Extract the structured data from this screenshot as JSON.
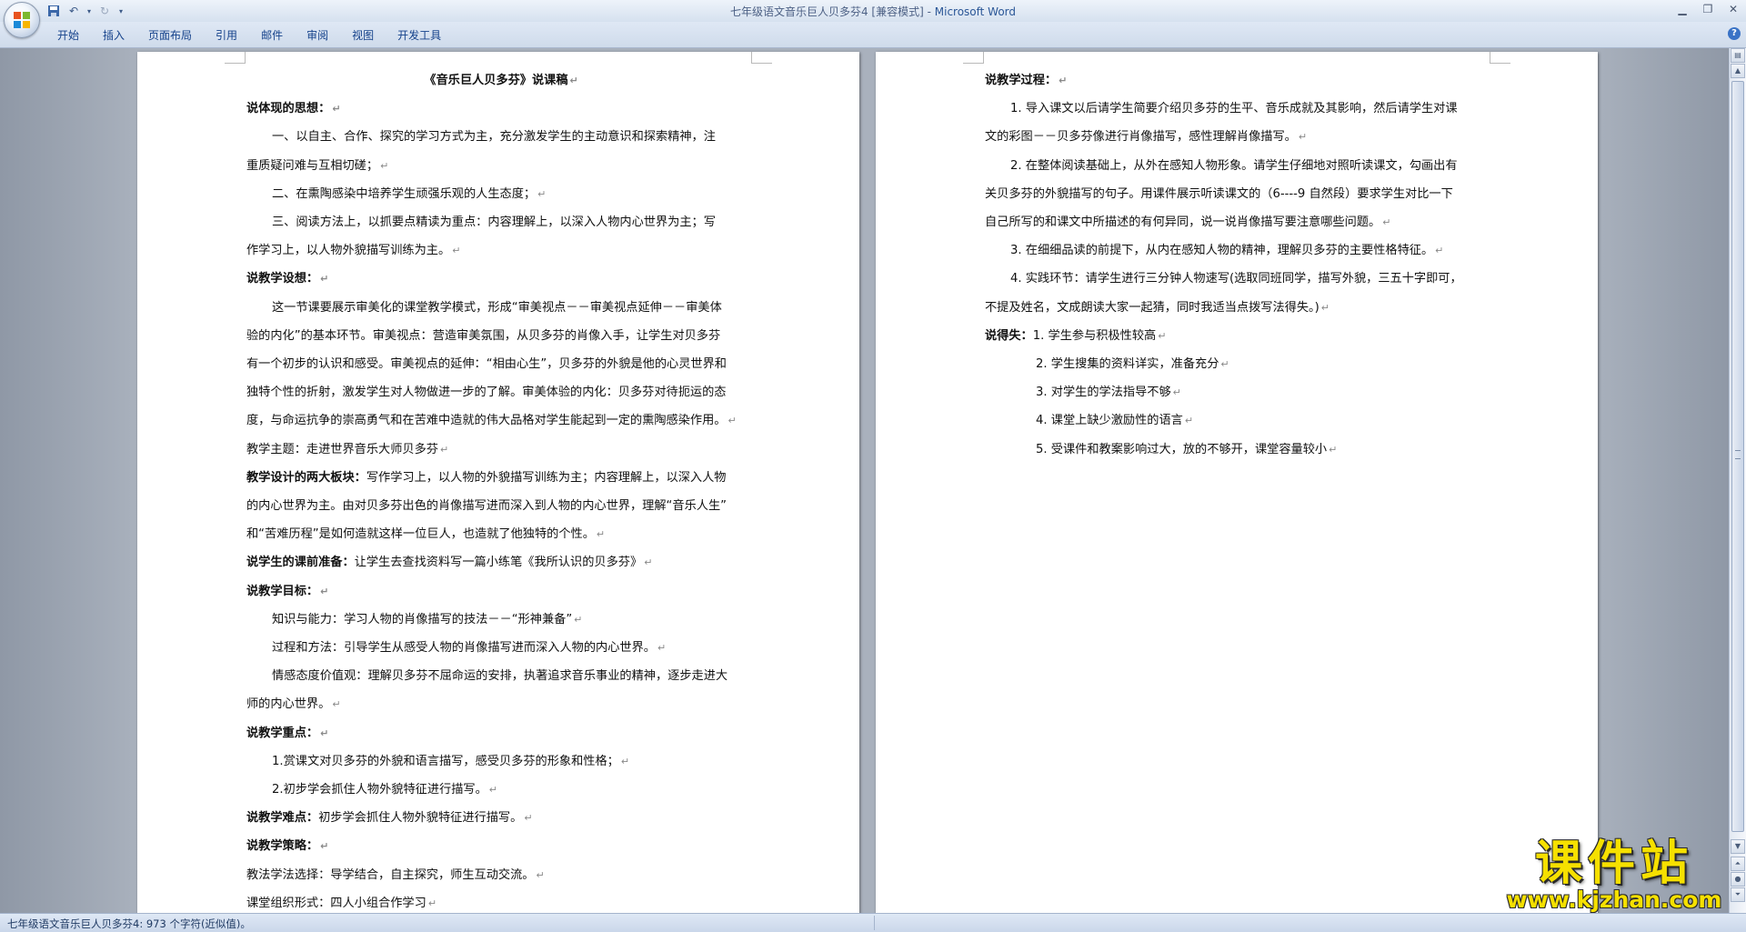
{
  "window": {
    "title": "七年级语文音乐巨人贝多芬4 [兼容模式] - ",
    "app_name": "Microsoft Word"
  },
  "ribbon": {
    "tabs": [
      "开始",
      "插入",
      "页面布局",
      "引用",
      "邮件",
      "审阅",
      "视图",
      "开发工具"
    ]
  },
  "page_left": {
    "title": "《音乐巨人贝多芬》说课稿",
    "s1_head": "说体现的思想：",
    "s1_p1_l1": "一、以自主、合作、探究的学习方式为主，充分激发学生的主动意识和探索精神，注",
    "s1_p1_l2": "重质疑问难与互相切磋；",
    "s1_p2": "二、在熏陶感染中培养学生顽强乐观的人生态度；",
    "s1_p3_l1": "三、阅读方法上，以抓要点精读为重点：内容理解上，以深入人物内心世界为主；写",
    "s1_p3_l2": "作学习上，以人物外貌描写训练为主。",
    "s2_head": "说教学设想：",
    "s2_l1": "这一节课要展示审美化的课堂教学模式，形成“审美视点－－审美视点延伸－－审美体",
    "s2_l2": "验的内化”的基本环节。审美视点：营造审美氛围，从贝多芬的肖像入手，让学生对贝多芬",
    "s2_l3": "有一个初步的认识和感受。审美视点的延伸：“相由心生”，贝多芬的外貌是他的心灵世界和",
    "s2_l4": "独特个性的折射，激发学生对人物做进一步的了解。审美体验的内化：贝多芬对待扼运的态",
    "s2_l5": "度，与命运抗争的崇高勇气和在苦难中造就的伟大品格对学生能起到一定的熏陶感染作用。",
    "theme": "教学主题：走进世界音乐大师贝多芬",
    "s3_head": "教学设计的两大板块：",
    "s3_l1": "写作学习上，以人物的外貌描写训练为主；内容理解上，以深入人物",
    "s3_l2": "的内心世界为主。由对贝多芬出色的肖像描写进而深入到人物的内心世界，理解“音乐人生”",
    "s3_l3": "和“苦难历程”是如何造就这样一位巨人，也造就了他独特的个性。",
    "s4_head": "说学生的课前准备：",
    "s4_body": "让学生去查找资料写一篇小练笔《我所认识的贝多芬》",
    "s5_head": "说教学目标：",
    "s5_g1": "知识与能力：学习人物的肖像描写的技法－－“形神兼备”",
    "s5_g2": "过程和方法：引导学生从感受人物的肖像描写进而深入人物的内心世界。",
    "s5_g3_l1": "情感态度价值观：理解贝多芬不屈命运的安排，执著追求音乐事业的精神，逐步走进大",
    "s5_g3_l2": "师的内心世界。",
    "s6_head": "说教学重点：",
    "s6_k1": "1.赏课文对贝多芬的外貌和语言描写，感受贝多芬的形象和性格；",
    "s6_k2": "2.初步学会抓住人物外貌特征进行描写。",
    "s7_head": "说教学难点：",
    "s7_body": "初步学会抓住人物外貌特征进行描写。",
    "s8_head": "说教学策略：",
    "s8_l1": "教法学法选择：导学结合，自主探究，师生互动交流。",
    "s8_l2": "课堂组织形式：四人小组合作学习"
  },
  "page_right": {
    "r_head": "说教学过程：",
    "r1_l1": "1. 导入课文以后请学生简要介绍贝多芬的生平、音乐成就及其影响，然后请学生对课",
    "r1_l2": "文的彩图－－贝多芬像进行肖像描写，感性理解肖像描写。",
    "r2_l1": "2. 在整体阅读基础上，从外在感知人物形象。请学生仔细地对照听读课文，勾画出有",
    "r2_l2": "关贝多芬的外貌描写的句子。用课件展示听读课文的（6----9 自然段）要求学生对比一下",
    "r2_l3": "自己所写的和课文中所描述的有何异同，说一说肖像描写要注意哪些问题。",
    "r3": "3. 在细细品读的前提下，从内在感知人物的精神，理解贝多芬的主要性格特征。",
    "r4_l1": "4. 实践环节：请学生进行三分钟人物速写(选取同班同学，描写外貌，三五十字即可，",
    "r4_l2": "不提及姓名，文成朗读大家一起猜，同时我适当点拨写法得失。)",
    "f_head": "说得失：",
    "f1": "1. 学生参与积极性较高",
    "f2": "2. 学生搜集的资料详实，准备充分",
    "f3": "3. 对学生的学法指导不够",
    "f4": "4. 课堂上缺少激励性的语言",
    "f5": "5. 受课件和教案影响过大，放的不够开，课堂容量较小"
  },
  "status": {
    "text": "七年级语文音乐巨人贝多芬4: 973 个字符(近似值)。"
  },
  "watermark": {
    "top": "课件站",
    "bottom": "www.kjzhan.com"
  }
}
